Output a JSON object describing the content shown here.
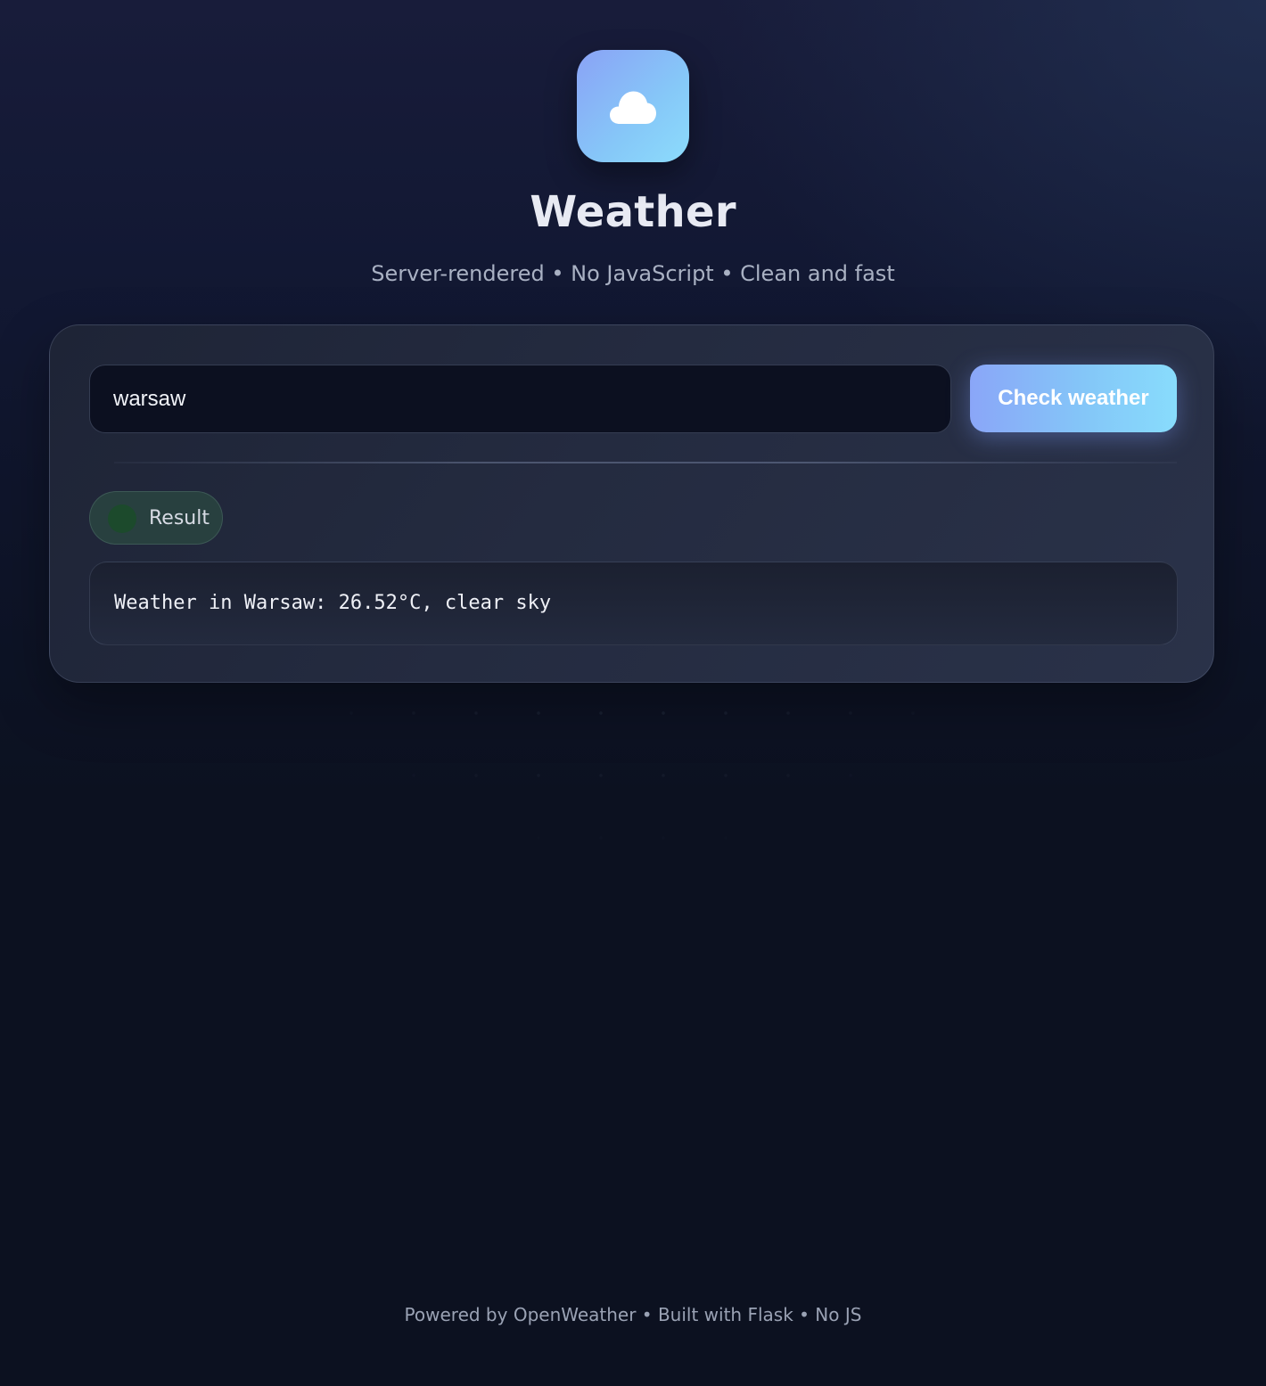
{
  "app": {
    "logo_icon": "cloud-icon",
    "title": "Weather",
    "subtitle": "Server-rendered • No JavaScript • Clean and fast"
  },
  "form": {
    "city_value": "warsaw",
    "submit_label": "Check weather"
  },
  "result": {
    "badge_label": "Result",
    "text": "Weather in Warsaw: 26.52°C, clear sky"
  },
  "footer": {
    "text": "Powered by OpenWeather • Built with Flask • No JS"
  },
  "colors": {
    "background": "#0c1120",
    "accent_start": "#8aa6f8",
    "accent_end": "#88dcfc",
    "card": "#242b40",
    "status_dot": "#1c4a2c"
  }
}
